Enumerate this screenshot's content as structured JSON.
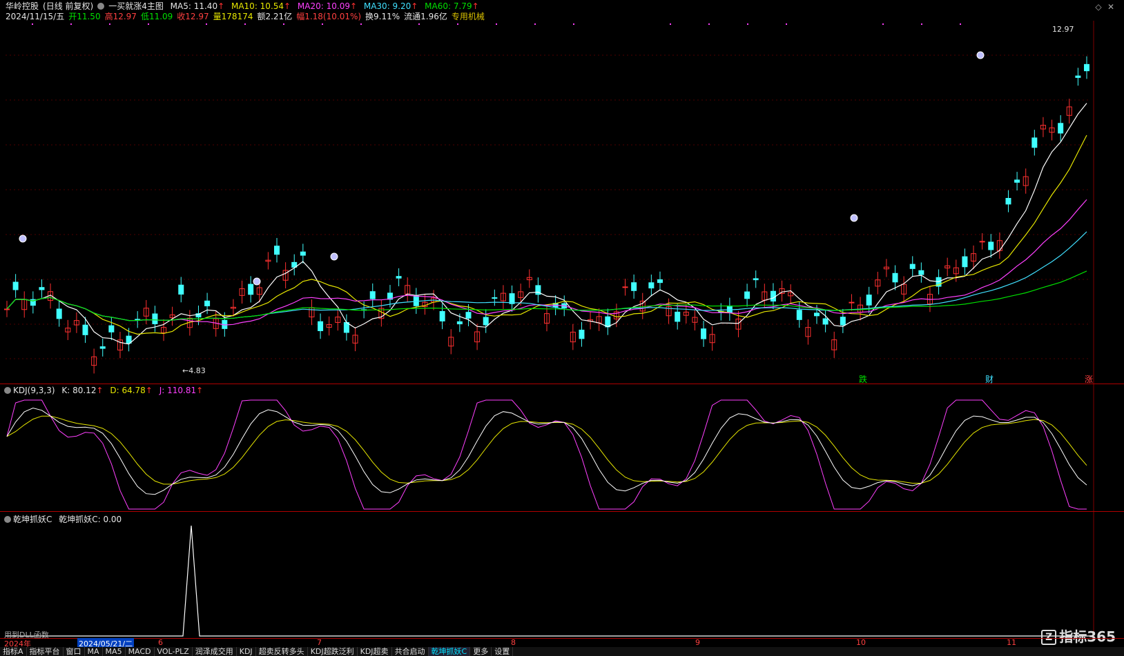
{
  "header": {
    "stock_name": "华岭控股",
    "period": "(日线 前复权)",
    "indicator": "一买就涨4主图",
    "ma5": "MA5: 11.40",
    "ma10": "MA10: 10.54",
    "ma20": "MA20: 10.09",
    "ma30": "MA30: 9.20",
    "ma60": "MA60: 7.79",
    "arrow": "↑"
  },
  "quote": {
    "date": "2024/11/15/五",
    "open": "开11.50",
    "high": "高12.97",
    "low": "低11.09",
    "close": "收12.97",
    "volume": "量178174",
    "amount": "额2.21亿",
    "change": "幅1.18(10.01%)",
    "turnover": "换9.11%",
    "float": "流通1.96亿",
    "sector": "专用机械"
  },
  "main_chart": {
    "high_label": "12.97",
    "low_label": "4.83",
    "signals": [
      "跌",
      "财",
      "涨"
    ]
  },
  "kdj": {
    "title": "KDJ(9,3,3)",
    "k": "K: 80.12",
    "d": "D: 64.78",
    "j": "J: 110.81",
    "arrow": "↑"
  },
  "qkzy": {
    "title": "乾坤抓妖C",
    "value": "乾坤抓妖C: 0.00"
  },
  "dates": {
    "year": "2024年",
    "cursor": "2024/05/21/二",
    "months": [
      "6",
      "7",
      "8",
      "9",
      "10",
      "11"
    ]
  },
  "dll_text": "用到DLL函数",
  "tabs": [
    "指标A",
    "指标平台",
    "窗口",
    "MA",
    "MA5",
    "MACD",
    "VOL-PLZ",
    "润泽成交用",
    "KDJ",
    "超卖反转多头",
    "KDJ超跌泛利",
    "KDJ超卖",
    "共合启动",
    "乾坤抓妖C",
    "更多",
    "设置"
  ],
  "active_tab": "乾坤抓妖C",
  "logo": "指标365",
  "colors": {
    "up": "#ff3030",
    "down": "#40ffff",
    "ma5": "#ffffff",
    "ma10": "#e6e600",
    "ma20": "#ff40ff",
    "ma30": "#40e0ff",
    "ma60": "#00e000"
  }
}
